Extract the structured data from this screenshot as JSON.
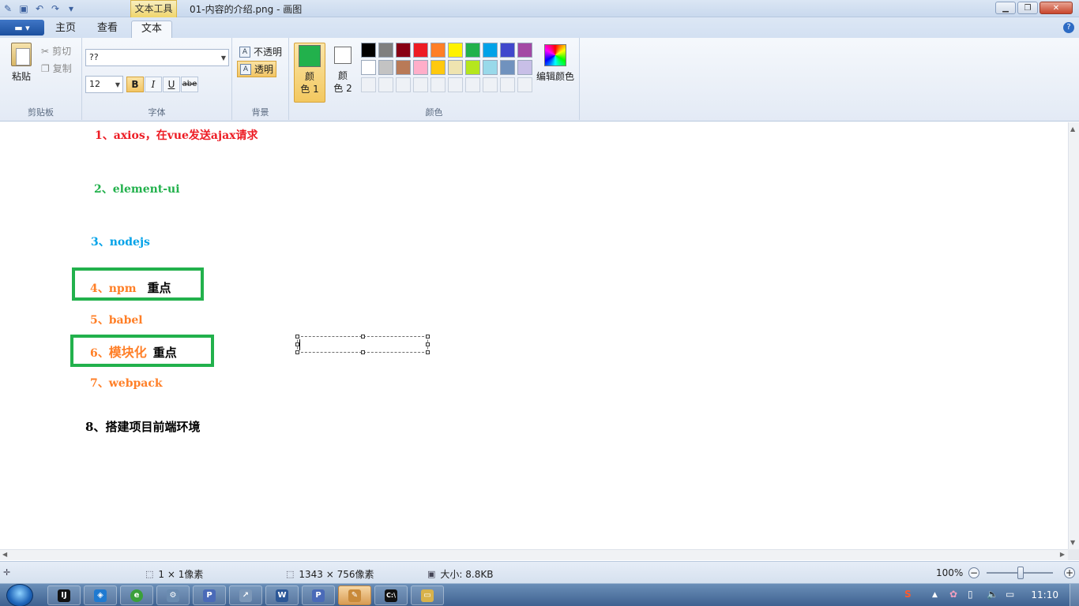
{
  "window": {
    "title": "01-内容的介绍.png - 画图",
    "context_tab": "文本工具"
  },
  "tabs": [
    {
      "label": "主页"
    },
    {
      "label": "查看"
    },
    {
      "label": "文本",
      "active": true
    }
  ],
  "ribbon": {
    "clipboard": {
      "paste": "粘贴",
      "cut": "剪切",
      "copy": "复制",
      "label": "剪贴板"
    },
    "font": {
      "family": "??",
      "size": "12",
      "bold": "B",
      "italic": "I",
      "underline": "U",
      "strike": "abe",
      "label": "字体"
    },
    "background": {
      "opaque": "不透明",
      "transparent": "透明",
      "label": "背景"
    },
    "colors": {
      "color1_line1": "颜",
      "color1_line2": "色 1",
      "color2_line1": "颜",
      "color2_line2": "色 2",
      "color1": "#22b14c",
      "color2": "#ffffff",
      "edit": "编辑颜色",
      "label": "颜色",
      "palette_row1": [
        "#000000",
        "#7f7f7f",
        "#880015",
        "#ed1c24",
        "#ff7f27",
        "#fff200",
        "#22b14c",
        "#00a2e8",
        "#3f48cc",
        "#a349a4"
      ],
      "palette_row2": [
        "#ffffff",
        "#c3c3c3",
        "#b97a57",
        "#ffaec9",
        "#ffc90e",
        "#efe4b0",
        "#b5e61d",
        "#99d9ea",
        "#7092be",
        "#c8bfe7"
      ]
    }
  },
  "canvas": {
    "lines": [
      {
        "num": "1、",
        "text": "axios，在vue发送ajax请求",
        "color": "#ed1c24"
      },
      {
        "num": "2、",
        "text": "element-ui",
        "color": "#22b14c"
      },
      {
        "num": "3、",
        "text": "nodejs",
        "color": "#00a2e8"
      },
      {
        "num": "4、",
        "text": "npm",
        "extra": "重点",
        "color": "#ff7f27"
      },
      {
        "num": "5、",
        "text": "babel",
        "color": "#ff7f27"
      },
      {
        "num": "6、",
        "text": "模块化",
        "extra": "重点",
        "color": "#ff7f27"
      },
      {
        "num": "7、",
        "text": "webpack",
        "color": "#ff7f27"
      },
      {
        "num": "8、",
        "text": "搭建项目前端环境",
        "color": "#000000"
      }
    ]
  },
  "statusbar": {
    "selection": "1 × 1像素",
    "image_size": "1343 × 756像素",
    "file_size": "大小: 8.8KB",
    "zoom": "100%"
  },
  "taskbar": {
    "clock": "11:10",
    "apps": [
      "intellij-idea",
      "vscode",
      "browser",
      "gear-app",
      "ppt",
      "tool",
      "word",
      "ppt2",
      "paint",
      "cmd",
      "explorer"
    ]
  }
}
